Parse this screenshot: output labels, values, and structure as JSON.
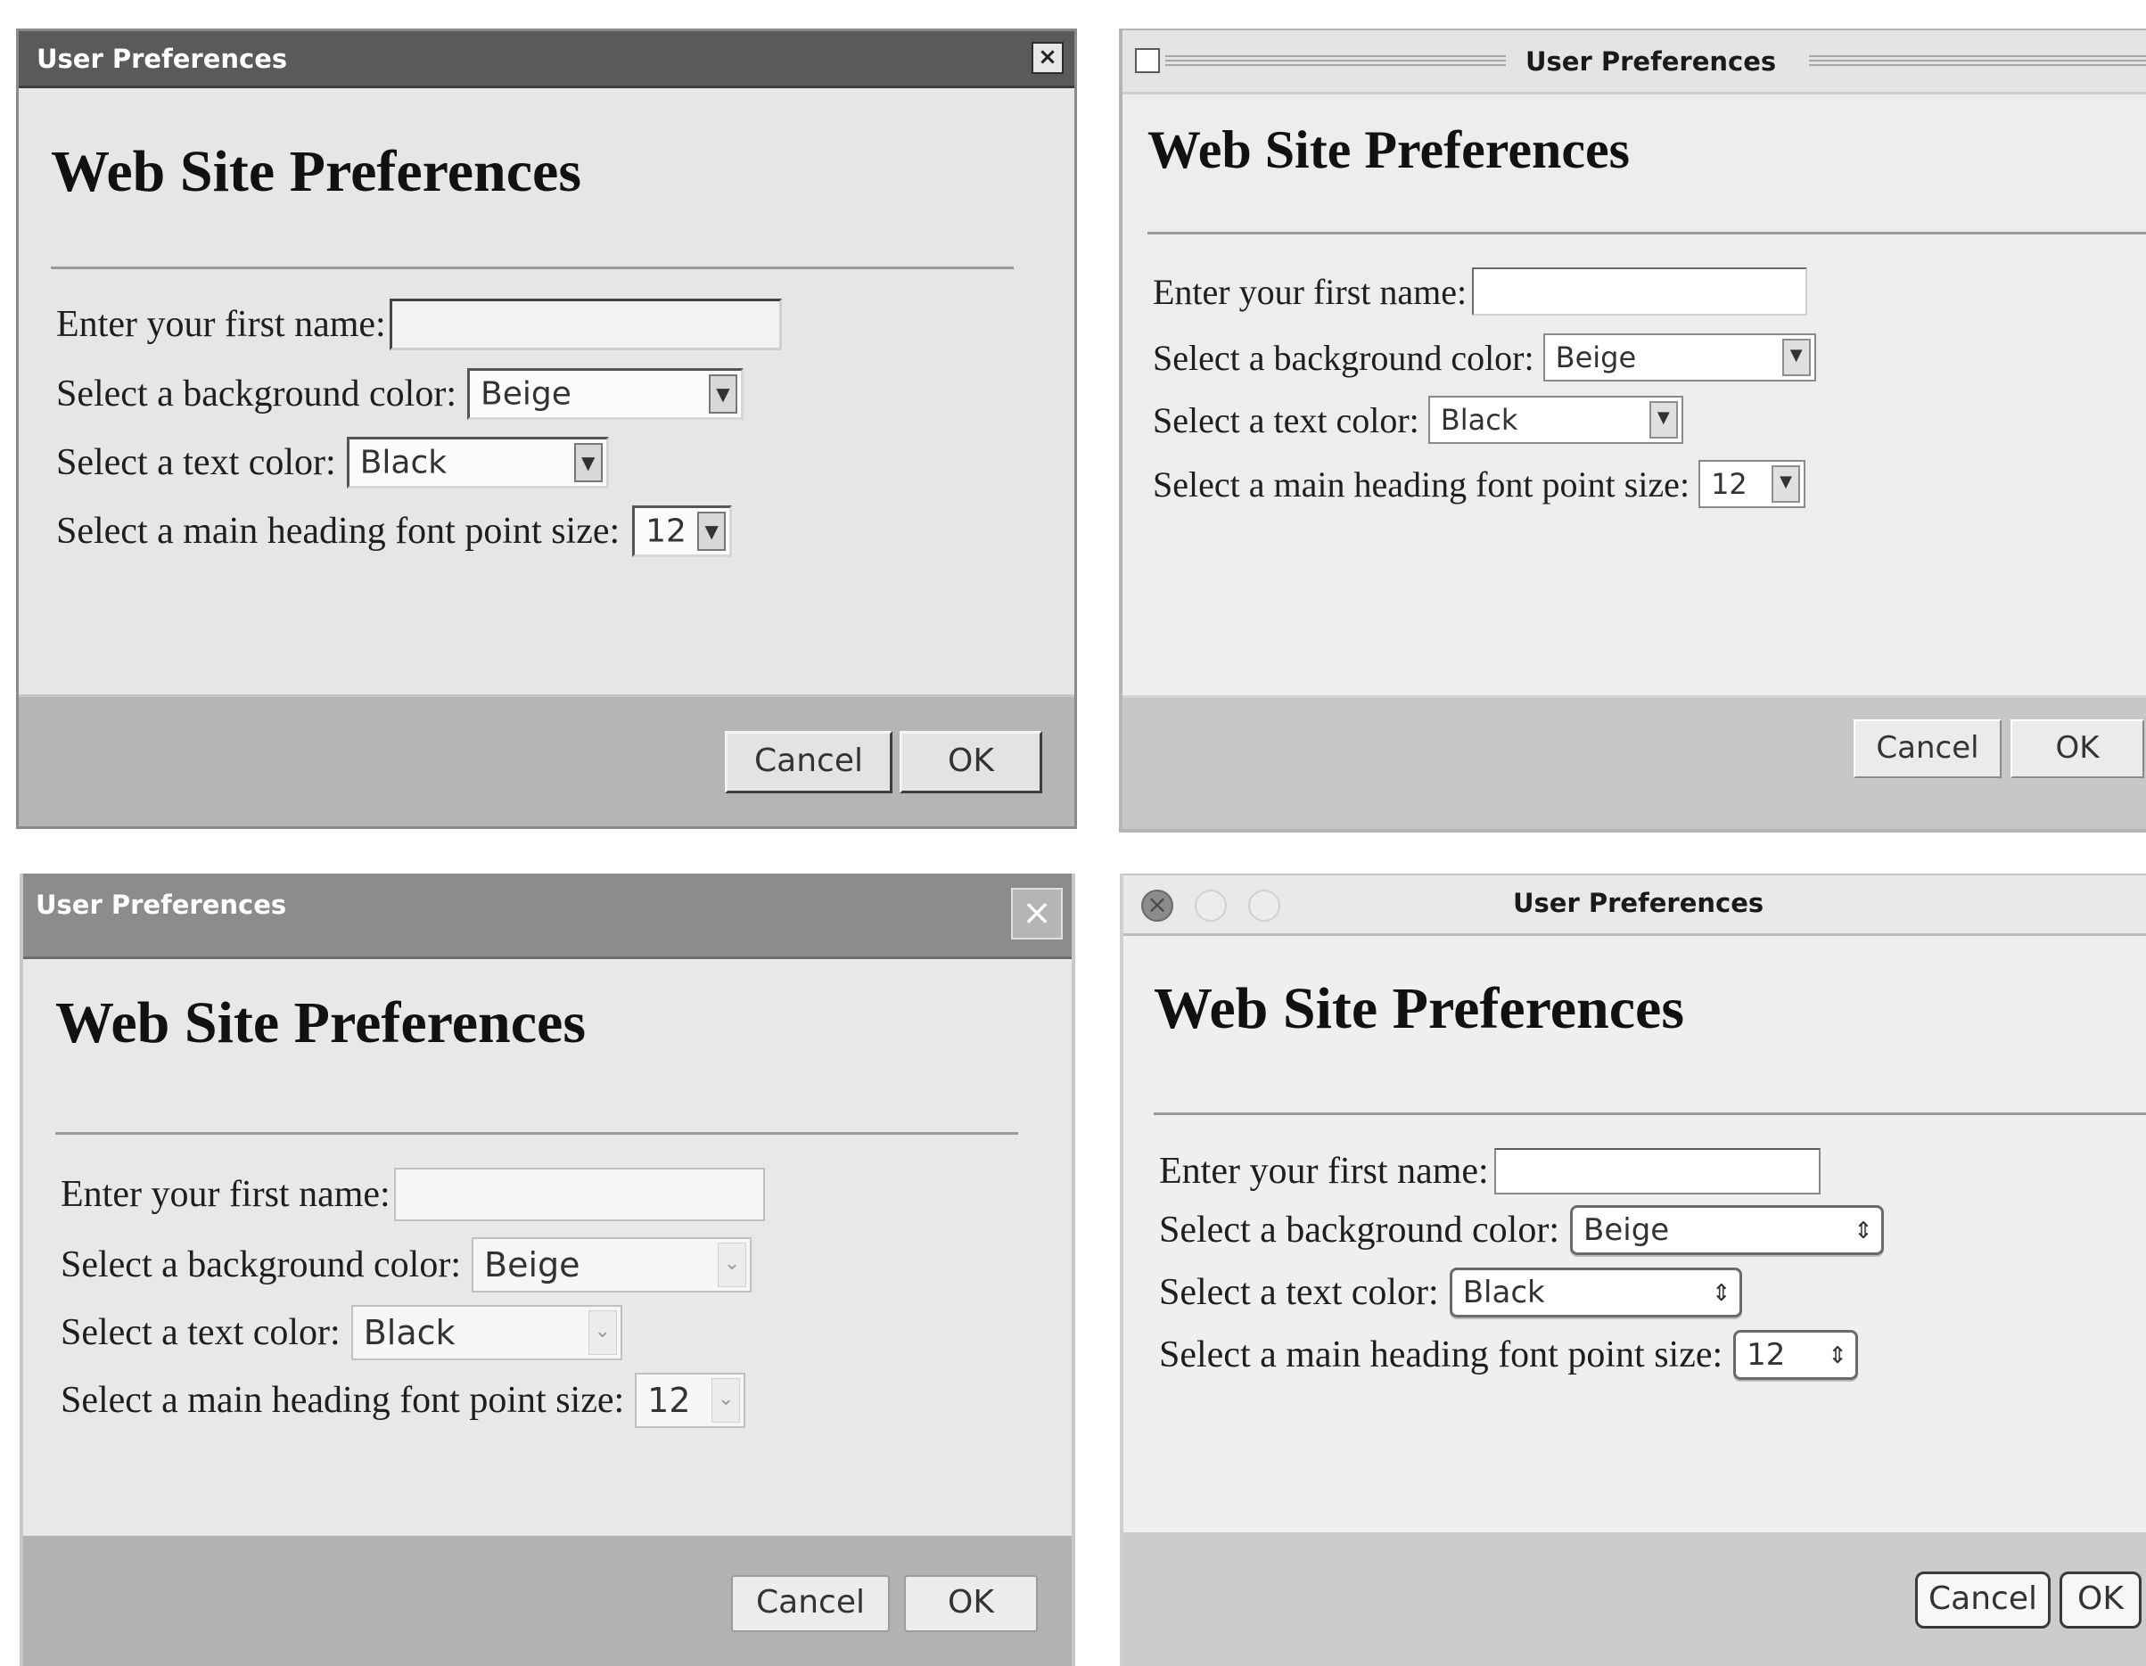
{
  "panels": [
    {
      "window_title": "User Preferences",
      "heading": "Web Site Preferences",
      "form": {
        "first_name_label": "Enter your first name:",
        "first_name_value": "",
        "bg_color_label": "Select a background color:",
        "bg_color_value": "Beige",
        "text_color_label": "Select a text color:",
        "text_color_value": "Black",
        "font_size_label": "Select a main heading font point size:",
        "font_size_value": "12"
      },
      "buttons": {
        "cancel": "Cancel",
        "ok": "OK"
      },
      "close_glyph": "×",
      "icons": [
        "close-icon",
        "dropdown-arrow-icon"
      ]
    },
    {
      "window_title": "User Preferences",
      "heading": "Web Site Preferences",
      "form": {
        "first_name_label": "Enter your first name:",
        "first_name_value": "",
        "bg_color_label": "Select a background color:",
        "bg_color_value": "Beige",
        "text_color_label": "Select a text color:",
        "text_color_value": "Black",
        "font_size_label": "Select a main heading font point size:",
        "font_size_value": "12"
      },
      "buttons": {
        "cancel": "Cancel",
        "ok": "OK"
      },
      "icons": [
        "window-menu-icon",
        "dropdown-arrow-icon"
      ]
    },
    {
      "window_title": "User Preferences",
      "heading": "Web Site Preferences",
      "form": {
        "first_name_label": "Enter your first name:",
        "first_name_value": "",
        "bg_color_label": "Select a background color:",
        "bg_color_value": "Beige",
        "text_color_label": "Select a text color:",
        "text_color_value": "Black",
        "font_size_label": "Select a main heading font point size:",
        "font_size_value": "12"
      },
      "buttons": {
        "cancel": "Cancel",
        "ok": "OK"
      },
      "close_glyph": "×",
      "icons": [
        "close-icon",
        "chevron-down-icon"
      ]
    },
    {
      "window_title": "User Preferences",
      "heading": "Web Site Preferences",
      "form": {
        "first_name_label": "Enter your first name:",
        "first_name_value": "",
        "bg_color_label": "Select a background color:",
        "bg_color_value": "Beige",
        "text_color_label": "Select a text color:",
        "text_color_value": "Black",
        "font_size_label": "Select a main heading font point size:",
        "font_size_value": "12"
      },
      "buttons": {
        "cancel": "Cancel",
        "ok": "OK"
      },
      "icons": [
        "close-light-icon",
        "minimize-light-icon",
        "zoom-light-icon",
        "up-down-arrows-icon"
      ]
    }
  ],
  "glyphs": {
    "dropdown_arrow": "▼",
    "chevron_down": "⌄",
    "up_down": "⇕"
  }
}
